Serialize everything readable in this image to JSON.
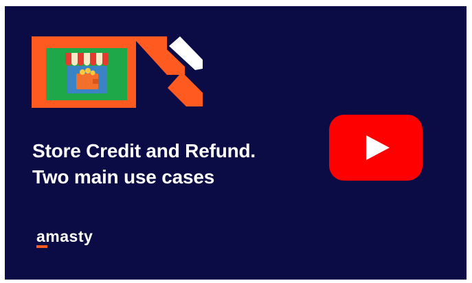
{
  "video": {
    "title_line1": "Store Credit and Refund.",
    "title_line2": "Two main use cases",
    "brand": "amasty"
  },
  "colors": {
    "background": "#0b0b45",
    "accent_orange": "#ff5a1f",
    "store_green": "#1fa84a",
    "play_red": "#ff0000"
  },
  "icons": [
    "store-logo-icon",
    "amasty-brand-mark-icon",
    "youtube-play-icon"
  ]
}
